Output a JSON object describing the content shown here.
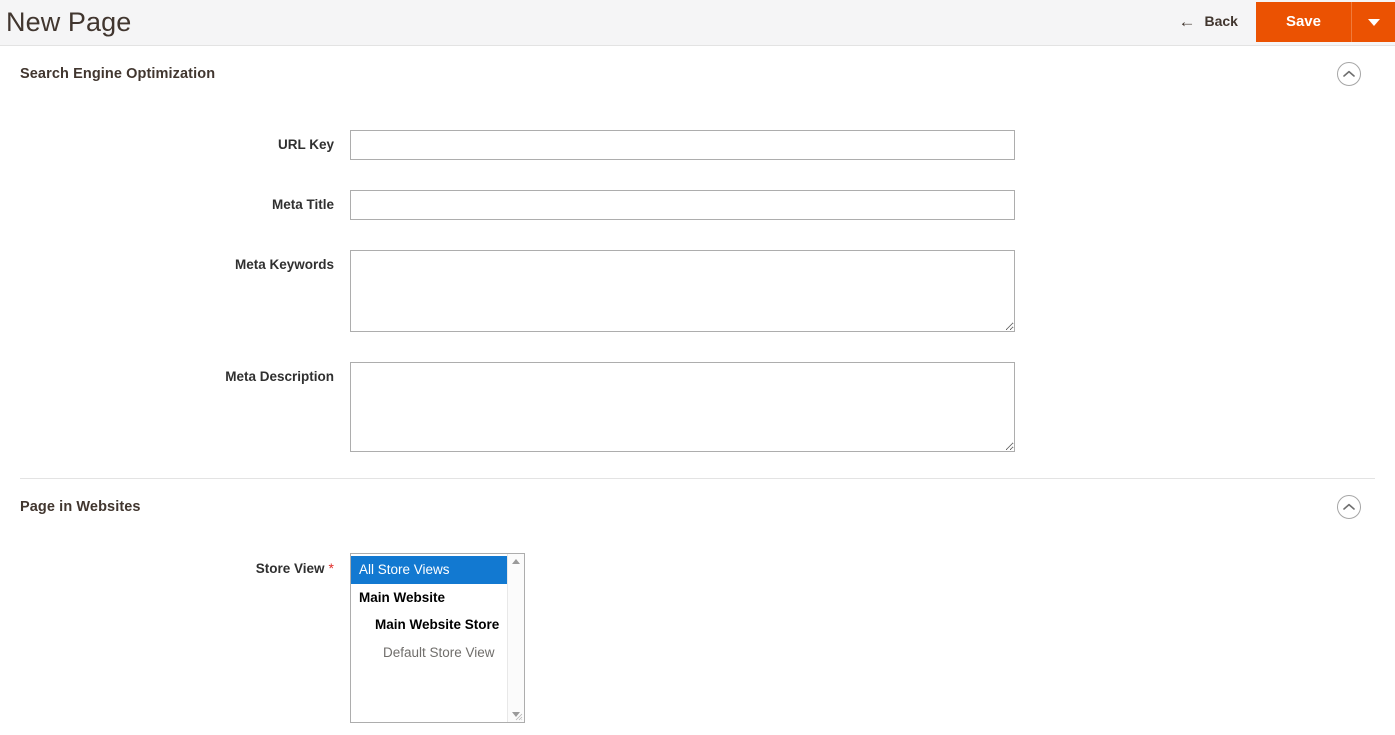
{
  "header": {
    "title": "New Page",
    "back_label": "Back",
    "back_icon": "arrow-left-icon",
    "save_label": "Save",
    "save_dropdown_icon": "caret-down-icon",
    "accent_color": "#eb5202",
    "background_color": "#f5f5f6"
  },
  "sections": [
    {
      "title": "Search Engine Optimization",
      "collapse_icon": "chevron-up-circle-icon",
      "expanded": true
    },
    {
      "title": "Page in Websites",
      "collapse_icon": "chevron-up-circle-icon",
      "expanded": true
    }
  ],
  "seo_fields": {
    "url_key": {
      "label": "URL Key",
      "value": "",
      "placeholder": "",
      "type": "text",
      "required": false
    },
    "meta_title": {
      "label": "Meta Title",
      "value": "",
      "placeholder": "",
      "type": "text",
      "required": false
    },
    "meta_keywords": {
      "label": "Meta Keywords",
      "value": "",
      "placeholder": "",
      "type": "textarea",
      "required": false
    },
    "meta_description": {
      "label": "Meta Description",
      "value": "",
      "placeholder": "",
      "type": "textarea",
      "required": false
    }
  },
  "websites_fields": {
    "store_view": {
      "label": "Store View",
      "required": true,
      "required_marker": "*",
      "required_color": "#e02b27",
      "selection_color": "#1279d1",
      "options": [
        {
          "label": "All Store Views",
          "level": "all",
          "selected": true
        },
        {
          "label": "Main Website",
          "level": "website",
          "selected": false
        },
        {
          "label": "Main Website Store",
          "level": "group",
          "selected": false
        },
        {
          "label": "Default Store View",
          "level": "view",
          "selected": false
        }
      ]
    }
  }
}
